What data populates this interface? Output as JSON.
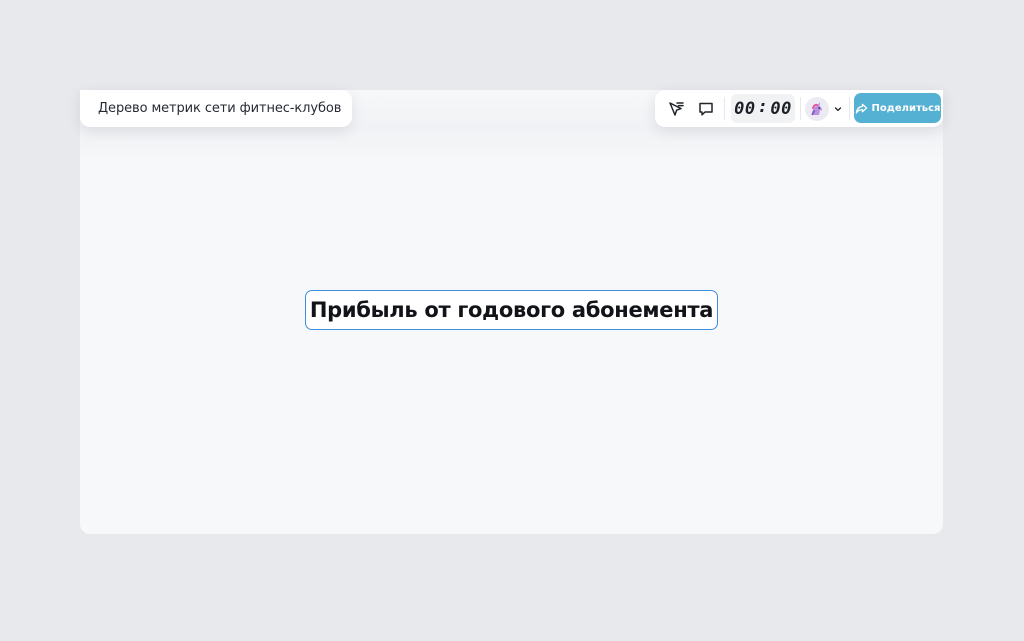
{
  "document": {
    "title": "Дерево метрик сети фитнес-клубов"
  },
  "toolbar": {
    "icons": [
      "filter-cursor-icon",
      "comment-icon"
    ],
    "timer": {
      "minutes": "00",
      "separator": ":",
      "seconds": "00"
    },
    "avatar_icon": "unicorn-icon",
    "share_label": "Поделиться",
    "share_color": "#55b1d4"
  },
  "canvas": {
    "root_node": {
      "label": "Прибыль от годового абонемента",
      "border_color": "#3d8fdc"
    }
  }
}
